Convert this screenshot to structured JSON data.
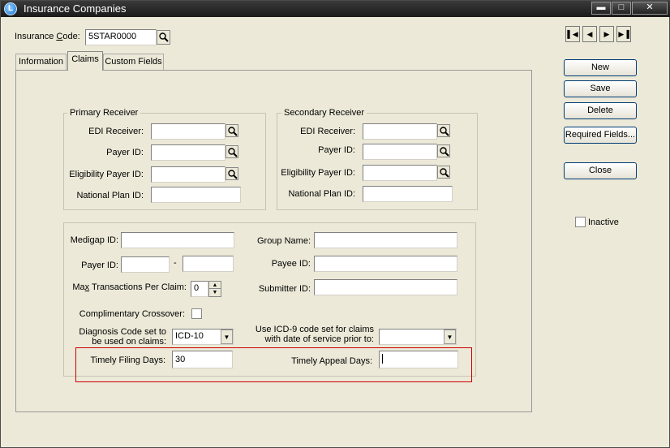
{
  "window": {
    "title": "Insurance Companies",
    "icon_name": "app-logo-icon",
    "controls": [
      "minimize-icon",
      "maximize-icon",
      "close-icon"
    ]
  },
  "header": {
    "code_label": "Insurance Code:",
    "code_value": "5STAR0000"
  },
  "tabs": [
    {
      "label": "Information",
      "selected": false
    },
    {
      "label": "Claims",
      "selected": true
    },
    {
      "label": "Custom Fields",
      "selected": false
    }
  ],
  "primary_receiver": {
    "title": "Primary Receiver",
    "edi_label": "EDI Receiver:",
    "edi_value": "",
    "payer_label": "Payer ID:",
    "payer_value": "",
    "eligibility_label": "Eligibility Payer ID:",
    "eligibility_value": "",
    "national_label": "National Plan ID:",
    "national_value": ""
  },
  "secondary_receiver": {
    "title": "Secondary Receiver",
    "edi_label": "EDI Receiver:",
    "edi_value": "",
    "payer_label": "Payer ID:",
    "payer_value": "",
    "eligibility_label": "Eligibility Payer ID:",
    "eligibility_value": "",
    "national_label": "National Plan ID:",
    "national_value": ""
  },
  "claim_settings": {
    "medigap_label": "Medigap ID:",
    "medigap_value": "",
    "payer_label": "Payer ID:",
    "payer_value_1": "",
    "payer_separator": "-",
    "payer_value_2": "",
    "max_tx_label": "Max Transactions Per Claim:",
    "max_tx_value": "0",
    "crossover_label": "Complimentary Crossover:",
    "crossover_checked": false,
    "diagnosis_label_1": "Diagnosis Code set to",
    "diagnosis_label_2": "be used on claims:",
    "diagnosis_value": "ICD-10",
    "group_label": "Group Name:",
    "group_value": "",
    "payee_label": "Payee ID:",
    "payee_value": "",
    "submitter_label": "Submitter ID:",
    "submitter_value": "",
    "icd9_label_1": "Use ICD-9 code set for claims",
    "icd9_label_2": "with date of service prior to:",
    "icd9_value": "",
    "timely_filing_label": "Timely Filing Days:",
    "timely_filing_value": "30",
    "timely_appeal_label": "Timely Appeal Days:",
    "timely_appeal_value": "",
    "highlight_color": "#cc0000"
  },
  "nav_buttons": [
    "first-record-icon",
    "previous-record-icon",
    "next-record-icon",
    "last-record-icon"
  ],
  "actions": {
    "new_label": "New",
    "save_label": "Save",
    "delete_label": "Delete",
    "required_label": "Required Fields...",
    "close_label": "Close",
    "inactive_label": "Inactive",
    "inactive_checked": false
  }
}
